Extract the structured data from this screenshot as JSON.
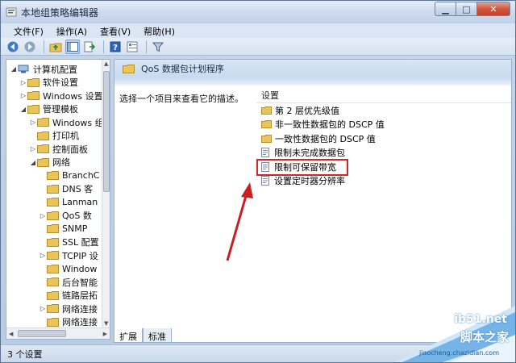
{
  "window": {
    "title": "本地组策略编辑器",
    "min_glyph": "▁",
    "max_glyph": "□",
    "close_glyph": "✕"
  },
  "menu": [
    {
      "label": "文件(F)"
    },
    {
      "label": "操作(A)"
    },
    {
      "label": "查看(V)"
    },
    {
      "label": "帮助(H)"
    }
  ],
  "toolbar": {
    "icons": [
      "back-arrow-icon",
      "forward-arrow-icon",
      "up-folder-icon",
      "show-hide-tree-icon",
      "export-list-icon",
      "help-icon",
      "properties-icon",
      "filter-icon"
    ]
  },
  "tree": {
    "items": [
      {
        "label": "计算机配置",
        "expanded": true
      },
      {
        "label": "软件设置",
        "expanded": false
      },
      {
        "label": "Windows 设置",
        "expanded": false
      },
      {
        "label": "管理模板",
        "expanded": true
      },
      {
        "label": "Windows 组",
        "expanded": false
      },
      {
        "label": "打印机",
        "expanded": null
      },
      {
        "label": "控制面板",
        "expanded": false
      },
      {
        "label": "网络",
        "expanded": true
      },
      {
        "label": "BranchC",
        "expanded": null
      },
      {
        "label": "DNS 客",
        "expanded": null
      },
      {
        "label": "Lanman",
        "expanded": null
      },
      {
        "label": "QoS 数",
        "expanded": false
      },
      {
        "label": "SNMP",
        "expanded": null
      },
      {
        "label": "SSL 配置",
        "expanded": null
      },
      {
        "label": "TCPIP 设",
        "expanded": false
      },
      {
        "label": "Window",
        "expanded": null
      },
      {
        "label": "后台智能",
        "expanded": null
      },
      {
        "label": "链路层拓",
        "expanded": null
      },
      {
        "label": "网络连接",
        "expanded": false
      },
      {
        "label": "网络连接",
        "expanded": null
      }
    ]
  },
  "right": {
    "header_title": "QoS 数据包计划程序",
    "description": "选择一个项目来查看它的描述。",
    "settings_header": "设置",
    "settings": [
      {
        "label": "第 2 层优先级值",
        "type": "folder"
      },
      {
        "label": "非一致性数据包的 DSCP 值",
        "type": "folder"
      },
      {
        "label": "一致性数据包的 DSCP 值",
        "type": "folder"
      },
      {
        "label": "限制未完成数据包",
        "type": "policy"
      },
      {
        "label": "限制可保留带宽",
        "type": "policy"
      },
      {
        "label": "设置定时器分辨率",
        "type": "policy"
      }
    ]
  },
  "tabs": [
    {
      "label": "扩展",
      "active": true
    },
    {
      "label": "标准",
      "active": false
    }
  ],
  "status": {
    "text": "3 个设置"
  },
  "watermark": {
    "site": "ib51.net",
    "tag": "脚本之家",
    "url": "jiaocheng.chazidian.com"
  },
  "colors": {
    "highlight": "#d52426",
    "folder": "#e8c45a",
    "watermark_blue": "#2b86cf"
  }
}
